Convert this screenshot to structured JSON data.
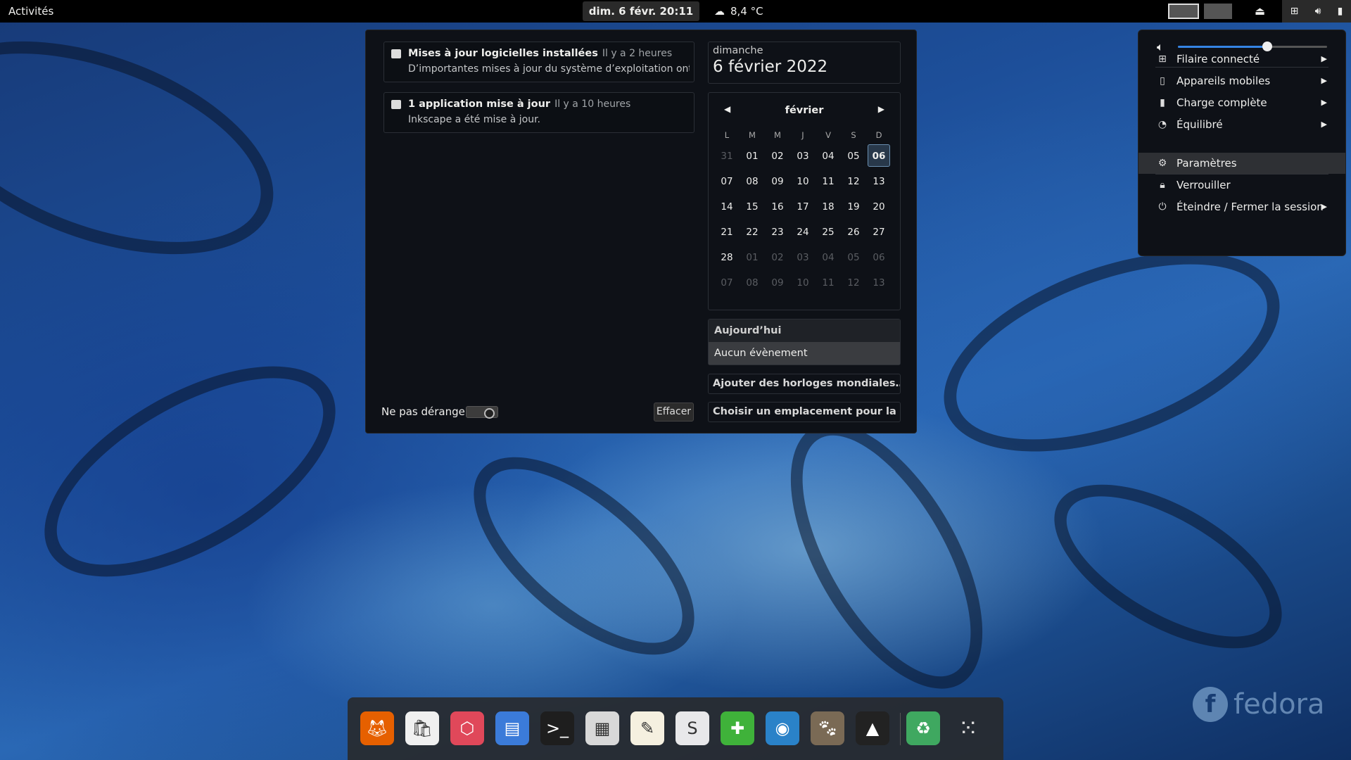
{
  "topbar": {
    "activities": "Activités",
    "clock": "dim. 6 févr.  20:11",
    "weather": "8,4 °C"
  },
  "notifications": [
    {
      "title": "Mises à jour logicielles installées",
      "time": "Il y a 2 heures",
      "body": "D’importantes mises à jour du système d’exploitation ont ét…"
    },
    {
      "title": "1 application mise à jour",
      "time": "Il y a 10 heures",
      "body": "Inkscape a été mise à jour."
    }
  ],
  "dnd_label": "Ne pas déranger",
  "clear_label": "Effacer",
  "date": {
    "dayname": "dimanche",
    "full": "6 février 2022"
  },
  "calendar": {
    "month": "février",
    "weekdays": [
      "L",
      "M",
      "M",
      "J",
      "V",
      "S",
      "D"
    ],
    "days": [
      [
        "31",
        "01",
        "02",
        "03",
        "04",
        "05",
        "06"
      ],
      [
        "07",
        "08",
        "09",
        "10",
        "11",
        "12",
        "13"
      ],
      [
        "14",
        "15",
        "16",
        "17",
        "18",
        "19",
        "20"
      ],
      [
        "21",
        "22",
        "23",
        "24",
        "25",
        "26",
        "27"
      ],
      [
        "28",
        "01",
        "02",
        "03",
        "04",
        "05",
        "06"
      ],
      [
        "07",
        "08",
        "09",
        "10",
        "11",
        "12",
        "13"
      ]
    ],
    "today": "06"
  },
  "events": {
    "header": "Aujourd’hui",
    "none": "Aucun évènement"
  },
  "world_clocks": "Ajouter des horloges mondiales…",
  "weather_location": "Choisir un emplacement pour la mét…",
  "sysmenu": {
    "volume_level": 0.6,
    "items": [
      {
        "label": "Filaire connecté",
        "icon": "network-wired-icon",
        "submenu": true
      },
      {
        "label": "Appareils mobiles",
        "icon": "phone-icon",
        "submenu": true
      },
      {
        "label": "Charge complète",
        "icon": "battery-icon",
        "submenu": true
      },
      {
        "label": "Équilibré",
        "icon": "power-profile-icon",
        "submenu": true
      },
      {
        "label": "Paramètres",
        "icon": "gear-icon",
        "submenu": false
      },
      {
        "label": "Verrouiller",
        "icon": "lock-icon",
        "submenu": false
      },
      {
        "label": "Éteindre / Fermer la session",
        "icon": "power-icon",
        "submenu": true
      }
    ]
  },
  "dock_apps": [
    {
      "name": "firefox",
      "color": "#e66000"
    },
    {
      "name": "software",
      "color": "#f0f0f0"
    },
    {
      "name": "boxes",
      "color": "#e0485a"
    },
    {
      "name": "files",
      "color": "#3b7bd9"
    },
    {
      "name": "terminal",
      "color": "#1e1e1e"
    },
    {
      "name": "calculator",
      "color": "#d8d8d8"
    },
    {
      "name": "text-editor",
      "color": "#f5f0e0"
    },
    {
      "name": "toolbox",
      "color": "#e8e8ea"
    },
    {
      "name": "extensions",
      "color": "#3fb23a"
    },
    {
      "name": "screenshot",
      "color": "#2a82c8"
    },
    {
      "name": "gimp",
      "color": "#7a6a55"
    },
    {
      "name": "inkscape",
      "color": "#222222"
    },
    {
      "name": "trash",
      "color": "#3fa860"
    },
    {
      "name": "app-grid",
      "color": "transparent"
    }
  ],
  "branding": "fedora"
}
